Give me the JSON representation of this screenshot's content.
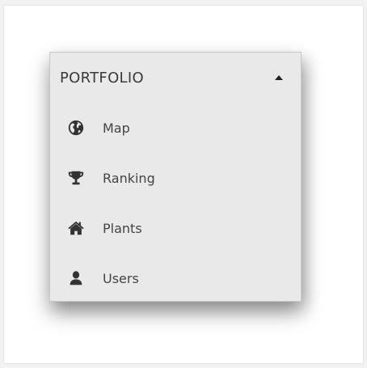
{
  "menu": {
    "title": "PORTFOLIO",
    "caret_icon": "caret-up-icon",
    "items": [
      {
        "label": "Map",
        "icon": "globe-icon"
      },
      {
        "label": "Ranking",
        "icon": "trophy-icon"
      },
      {
        "label": "Plants",
        "icon": "home-icon"
      },
      {
        "label": "Users",
        "icon": "user-icon"
      }
    ]
  },
  "colors": {
    "menu_background": "#e9e9e9",
    "icon": "#333333",
    "text": "#444444"
  }
}
